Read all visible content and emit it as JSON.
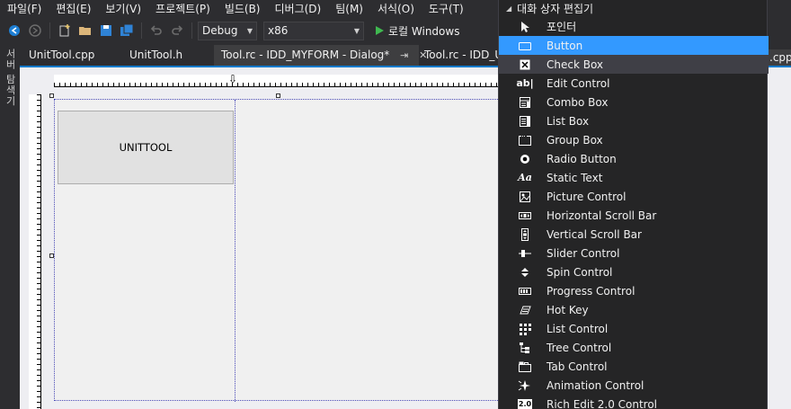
{
  "menu": [
    {
      "label": "파일(F)"
    },
    {
      "label": "편집(E)"
    },
    {
      "label": "보기(V)"
    },
    {
      "label": "프로젝트(P)"
    },
    {
      "label": "빌드(B)"
    },
    {
      "label": "디버그(D)"
    },
    {
      "label": "팀(M)"
    },
    {
      "label": "서식(O)"
    },
    {
      "label": "도구(T)"
    }
  ],
  "toolbar": {
    "config": "Debug",
    "platform": "x86",
    "run_label": "로컬 Windows"
  },
  "side_strip": {
    "label": "서버 탐색기"
  },
  "doc_tabs": [
    {
      "label": "UnitTool.cpp"
    },
    {
      "label": "UnitTool.h"
    },
    {
      "label": "Tool.rc - IDD_MYFORM - Dialog*"
    },
    {
      "label": "Tool.rc - IDD_U"
    }
  ],
  "right_tab_fragment": ".cpp",
  "dialog": {
    "button_label": "UNITTOOL"
  },
  "toolbox": {
    "header": "대화 상자 편집기",
    "items": [
      {
        "label": "포인터",
        "icon": "pointer-icon"
      },
      {
        "label": "Button",
        "icon": "button-icon",
        "state": "selected"
      },
      {
        "label": "Check Box",
        "icon": "checkbox-icon",
        "state": "hovered"
      },
      {
        "label": "Edit Control",
        "icon": "edit-control-icon"
      },
      {
        "label": "Combo Box",
        "icon": "combo-box-icon"
      },
      {
        "label": "List Box",
        "icon": "list-box-icon"
      },
      {
        "label": "Group Box",
        "icon": "group-box-icon"
      },
      {
        "label": "Radio Button",
        "icon": "radio-button-icon"
      },
      {
        "label": "Static Text",
        "icon": "static-text-icon"
      },
      {
        "label": "Picture Control",
        "icon": "picture-control-icon"
      },
      {
        "label": "Horizontal Scroll Bar",
        "icon": "hscroll-icon"
      },
      {
        "label": "Vertical Scroll Bar",
        "icon": "vscroll-icon"
      },
      {
        "label": "Slider Control",
        "icon": "slider-icon"
      },
      {
        "label": "Spin Control",
        "icon": "spin-icon"
      },
      {
        "label": "Progress Control",
        "icon": "progress-icon"
      },
      {
        "label": "Hot Key",
        "icon": "hotkey-icon"
      },
      {
        "label": "List Control",
        "icon": "list-control-icon"
      },
      {
        "label": "Tree Control",
        "icon": "tree-control-icon"
      },
      {
        "label": "Tab Control",
        "icon": "tab-control-icon"
      },
      {
        "label": "Animation Control",
        "icon": "animation-icon"
      },
      {
        "label": "Rich Edit 2.0 Control",
        "icon": "rich-edit-icon"
      }
    ]
  },
  "colors": {
    "accent": "#007acc",
    "selection": "#3399ff",
    "run": "#3fb950"
  }
}
